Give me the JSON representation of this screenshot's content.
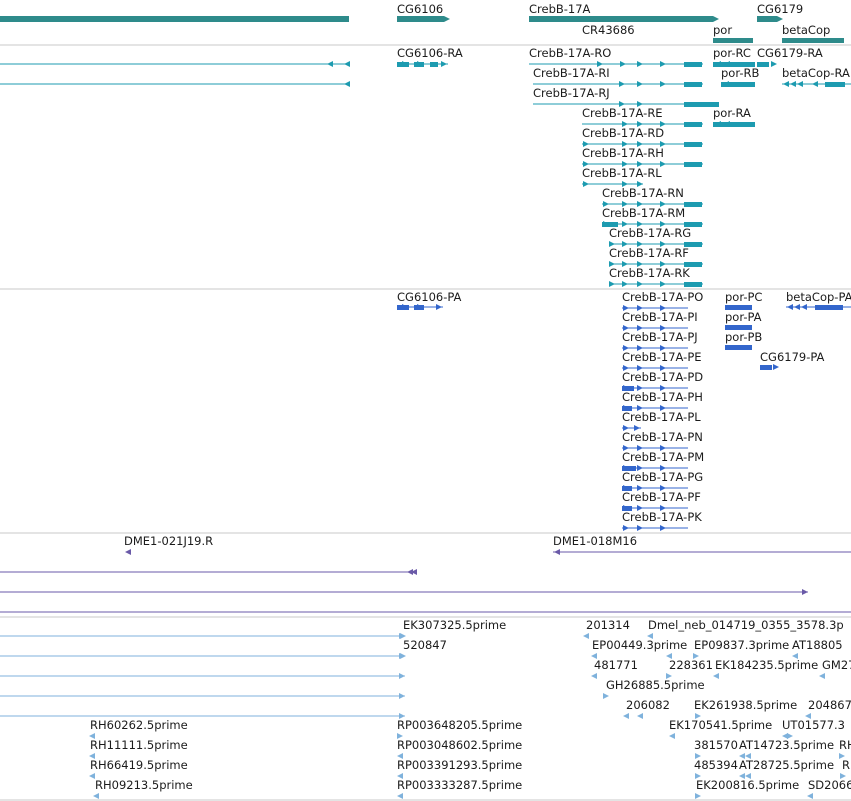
{
  "colors": {
    "gene": "#2e8b8b",
    "mrna": "#1d9bb0",
    "protein": "#3366cc",
    "clone": "#6a5aa8",
    "est": "#7fb2dc",
    "separator": "#c8c8c8"
  },
  "tracks": {
    "genes": [
      "CG6106",
      "CrebB-17A",
      "CG6179",
      "CR43686",
      "por",
      "betaCop"
    ],
    "transcripts": [
      "CG6106-RA",
      "CrebB-17A-RO",
      "por-RC",
      "CG6179-RA",
      "CrebB-17A-RI",
      "por-RB",
      "betaCop-RA",
      "CrebB-17A-RJ",
      "CrebB-17A-RE",
      "por-RA",
      "CrebB-17A-RD",
      "CrebB-17A-RH",
      "CrebB-17A-RL",
      "CrebB-17A-RN",
      "CrebB-17A-RM",
      "CrebB-17A-RG",
      "CrebB-17A-RF",
      "CrebB-17A-RK"
    ],
    "proteins": [
      "CG6106-PA",
      "CrebB-17A-PO",
      "por-PC",
      "betaCop-PA",
      "CrebB-17A-PI",
      "por-PA",
      "CrebB-17A-PJ",
      "por-PB",
      "CrebB-17A-PE",
      "CG6179-PA",
      "CrebB-17A-PD",
      "CrebB-17A-PH",
      "CrebB-17A-PL",
      "CrebB-17A-PN",
      "CrebB-17A-PM",
      "CrebB-17A-PG",
      "CrebB-17A-PF",
      "CrebB-17A-PK"
    ],
    "clones": [
      "DME1-021J19.R",
      "DME1-018M16"
    ],
    "ests": [
      "EK307325.5prime",
      "201314",
      "Dmel_neb_014719_0355_3578.3p",
      "520847",
      "EP00449.3prime",
      "EP09837.3prime",
      "AT18805",
      "481771",
      "228361",
      "EK184235.5prime",
      "GM27",
      "GH26885.5prime",
      "206082",
      "EK261938.5prime",
      "204867",
      "RH60262.5prime",
      "RP003648205.5prime",
      "EK170541.5prime",
      "UT01577.3",
      "RH11111.5prime",
      "RP003048602.5prime",
      "381570",
      "AT14723.5prime",
      "RH",
      "RH66419.5prime",
      "RP003391293.5prime",
      "485394",
      "AT28725.5prime",
      "RH",
      "RH09213.5prime",
      "RP003333287.5prime",
      "EK200816.5prime",
      "SD2066"
    ]
  }
}
